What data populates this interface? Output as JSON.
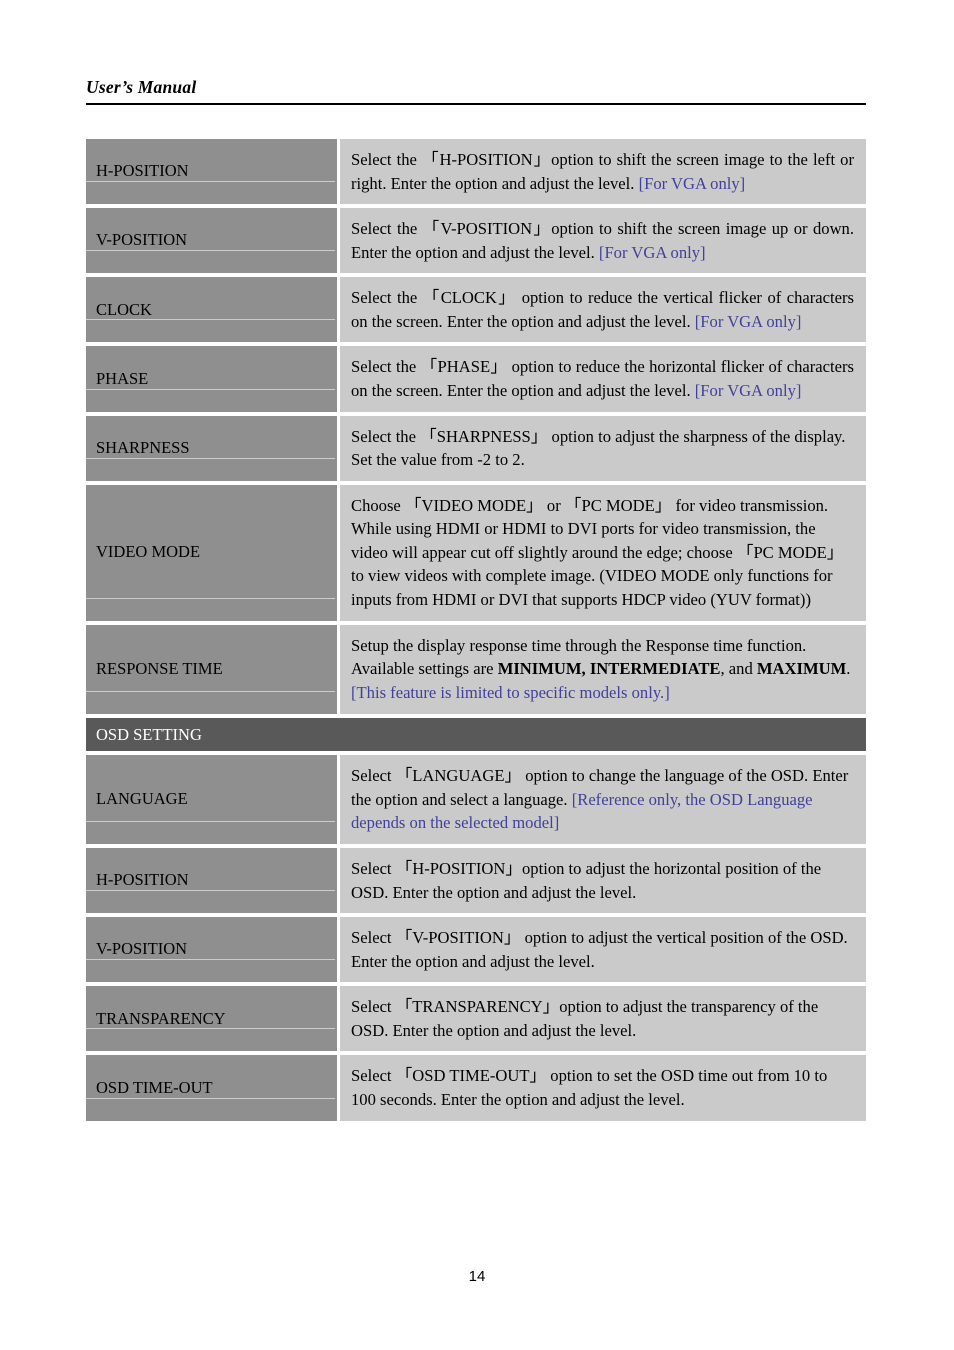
{
  "header": {
    "title": "User’s Manual",
    "rule": true
  },
  "footer": {
    "page_number": "14"
  },
  "colors": {
    "key_cell_bg": "#8f8f8f",
    "desc_cell_bg": "#cacaca",
    "section_bar_bg": "#595959",
    "note_blue": "#41419b",
    "page_bg": "#ffffff",
    "text": "#000000"
  },
  "table": {
    "rows": [
      {
        "type": "entry",
        "key": "H-POSITION",
        "desc_segments": [
          {
            "text": "Select the ",
            "style": "normal"
          },
          {
            "text": "「H-POSITION」",
            "style": "bracket"
          },
          {
            "text": "option to shift the screen image to the left or right. Enter the option and adjust the level. ",
            "style": "normal"
          },
          {
            "text": "[For VGA only]",
            "style": "blue"
          }
        ],
        "align": "justify"
      },
      {
        "type": "entry",
        "key": "V-POSITION",
        "desc_segments": [
          {
            "text": "Select the ",
            "style": "normal"
          },
          {
            "text": "「V-POSITION」",
            "style": "bracket"
          },
          {
            "text": "option to shift the screen image up or down. Enter the option and adjust the level. ",
            "style": "normal"
          },
          {
            "text": "[For VGA only]",
            "style": "blue"
          }
        ],
        "align": "justify"
      },
      {
        "type": "entry",
        "key": "CLOCK",
        "desc_segments": [
          {
            "text": "Select the ",
            "style": "normal"
          },
          {
            "text": " 「CLOCK」",
            "style": "bracket"
          },
          {
            "text": " option to reduce the vertical flicker of characters on the screen. Enter the option and adjust the level. ",
            "style": "normal"
          },
          {
            "text": "[For VGA only]",
            "style": "blue"
          }
        ],
        "align": "justify"
      },
      {
        "type": "entry",
        "key": "PHASE",
        "desc_segments": [
          {
            "text": "Select the ",
            "style": "normal"
          },
          {
            "text": "「PHASE」",
            "style": "bracket"
          },
          {
            "text": " option to reduce the horizontal flicker of characters on the screen. Enter the option and adjust the level. ",
            "style": "normal"
          },
          {
            "text": "[For VGA only]",
            "style": "blue"
          }
        ],
        "align": "justify"
      },
      {
        "type": "entry",
        "key": "SHARPNESS",
        "desc_segments": [
          {
            "text": "Select the ",
            "style": "normal"
          },
          {
            "text": "「SHARPNESS」",
            "style": "bracket"
          },
          {
            "text": " option to adjust the sharpness of the display. Set the value from -2 to 2.",
            "style": "normal"
          }
        ],
        "align": "left"
      },
      {
        "type": "entry",
        "key": "VIDEO MODE",
        "desc_segments": [
          {
            "text": "Choose ",
            "style": "normal"
          },
          {
            "text": "「VIDEO MODE」",
            "style": "bracket"
          },
          {
            "text": " or  ",
            "style": "normal"
          },
          {
            "text": "「PC MODE」",
            "style": "bracket"
          },
          {
            "text": " for video transmission. While using HDMI or HDMI to DVI ports for video transmission, the video will appear cut off slightly around the edge; choose ",
            "style": "normal"
          },
          {
            "text": "「PC MODE」",
            "style": "bracket"
          },
          {
            "text": " to view videos with complete image. (VIDEO MODE only functions for inputs from HDMI or DVI that supports HDCP video (YUV format))",
            "style": "normal"
          }
        ],
        "align": "left"
      },
      {
        "type": "entry",
        "key": "RESPONSE TIME",
        "desc_segments": [
          {
            "text": "Setup the display response time through the Response time function. Available settings are ",
            "style": "normal"
          },
          {
            "text": "MINIMUM, INTERMEDIATE",
            "style": "bold"
          },
          {
            "text": ", and ",
            "style": "normal"
          },
          {
            "text": "MAXIMUM",
            "style": "bold"
          },
          {
            "text": ". ",
            "style": "normal"
          },
          {
            "text": "[This feature is limited to specific models only.]",
            "style": "blue"
          }
        ],
        "align": "left"
      },
      {
        "type": "section",
        "label": "OSD SETTING"
      },
      {
        "type": "entry",
        "key": "LANGUAGE",
        "desc_segments": [
          {
            "text": "Select  ",
            "style": "normal"
          },
          {
            "text": "「LANGUAGE」",
            "style": "bracket"
          },
          {
            "text": "  option to change the language of the OSD. Enter the option and select a language. ",
            "style": "normal"
          },
          {
            "text": "[Reference only, the OSD Language depends on the selected model]",
            "style": "blue"
          }
        ],
        "align": "left"
      },
      {
        "type": "entry",
        "key": "H-POSITION",
        "desc_segments": [
          {
            "text": "Select ",
            "style": "normal"
          },
          {
            "text": "「H-POSITION」",
            "style": "bracket"
          },
          {
            "text": "option to adjust the horizontal position of the OSD. Enter the option and adjust the level.",
            "style": "normal"
          }
        ],
        "align": "left"
      },
      {
        "type": "entry",
        "key": "V-POSITION",
        "desc_segments": [
          {
            "text": "Select  ",
            "style": "normal"
          },
          {
            "text": "「V-POSITION」",
            "style": "bracket"
          },
          {
            "text": " option to adjust the vertical position of the OSD. Enter the option and adjust the level.",
            "style": "normal"
          }
        ],
        "align": "left"
      },
      {
        "type": "entry",
        "key": "TRANSPARENCY",
        "desc_segments": [
          {
            "text": "Select ",
            "style": "normal"
          },
          {
            "text": "「TRANSPARENCY」",
            "style": "bracket"
          },
          {
            "text": "option to adjust the transparency of the OSD. Enter the option and adjust the level.",
            "style": "normal"
          }
        ],
        "align": "left"
      },
      {
        "type": "entry",
        "key": "OSD TIME-OUT",
        "desc_segments": [
          {
            "text": "Select  ",
            "style": "normal"
          },
          {
            "text": "「OSD TIME-OUT」",
            "style": "bracket"
          },
          {
            "text": " option to set the OSD time out from 10 to 100 seconds. Enter the option and adjust the level.",
            "style": "normal"
          }
        ],
        "align": "left"
      }
    ]
  }
}
